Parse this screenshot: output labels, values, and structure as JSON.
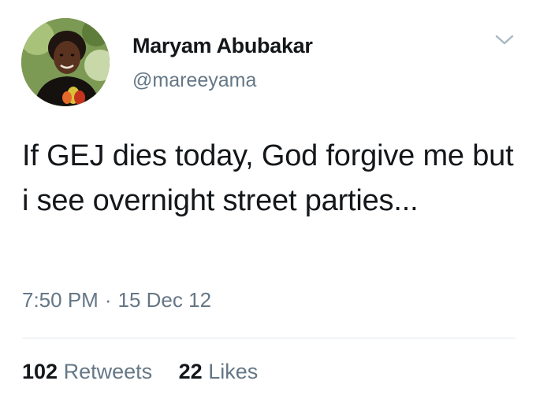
{
  "tweet": {
    "author": {
      "display_name": "Maryam Abubakar",
      "handle": "@mareeyama",
      "avatar_icon": "profile-photo"
    },
    "menu_icon": "chevron-down-icon",
    "text": "If GEJ dies today, God forgive me but i see overnight street parties...",
    "time": "7:50 PM",
    "separator": "·",
    "date": "15 Dec 12",
    "stats": {
      "retweets_count": "102",
      "retweets_label": "Retweets",
      "likes_count": "22",
      "likes_label": "Likes"
    }
  },
  "colors": {
    "text_primary": "#14171a",
    "text_secondary": "#657786",
    "divider": "#e1e8ed",
    "background": "#ffffff"
  }
}
